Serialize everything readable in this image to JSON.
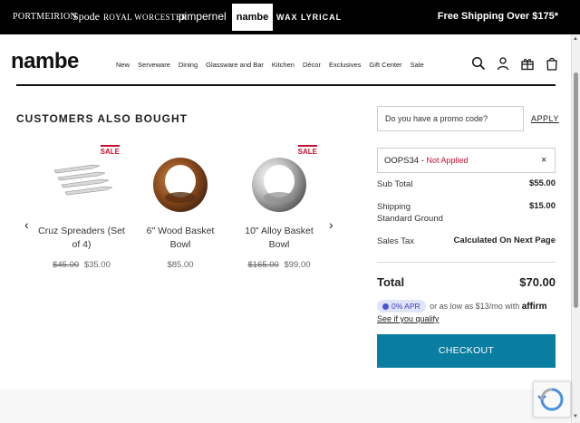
{
  "brandbar": {
    "brands": [
      "PORTMEIRION",
      "Spode",
      "ROYAL WORCESTER",
      "pimpernel",
      "nambe",
      "WAX LYRICAL"
    ],
    "shipping": "Free Shipping Over $175*"
  },
  "header": {
    "logo": "nambe",
    "nav": [
      "New",
      "Serveware",
      "Dining",
      "Glassware and Bar",
      "Kitchen",
      "Décor",
      "Exclusives",
      "Gift Center",
      "Sale"
    ],
    "icons": [
      "search-icon",
      "account-icon",
      "gift-icon",
      "cart-icon"
    ]
  },
  "recommendations": {
    "title": "CUSTOMERS ALSO BOUGHT",
    "products": [
      {
        "name": "Cruz Spreaders (Set of 4)",
        "was": "$45.00",
        "price": "$35.00",
        "badge": "SALE"
      },
      {
        "name": "6\" Wood Basket Bowl",
        "was": "",
        "price": "$85.00",
        "badge": ""
      },
      {
        "name": "10\" Alloy Basket Bowl",
        "was": "$165.00",
        "price": "$99.00",
        "badge": "SALE"
      }
    ]
  },
  "summary": {
    "promo_placeholder": "Do you have a promo code?",
    "apply_label": "APPLY",
    "code": "OOPS34 - ",
    "code_status": "Not Applied",
    "close": "×",
    "subtotal_label": "Sub Total",
    "subtotal": "$55.00",
    "shipping_label": "Shipping",
    "shipping_method": "Standard Ground",
    "shipping": "$15.00",
    "tax_label": "Sales Tax",
    "tax": "Calculated On Next Page",
    "total_label": "Total",
    "total": "$70.00",
    "apr": "0% APR",
    "affirm_text": " or as low as $13/mo with ",
    "affirm_brand": "affirm",
    "qualify": "See if you qualify",
    "checkout": "CHECKOUT"
  },
  "colors": {
    "accent": "#0a7ea1",
    "sale": "#c8102e",
    "topbar": "#000000"
  }
}
